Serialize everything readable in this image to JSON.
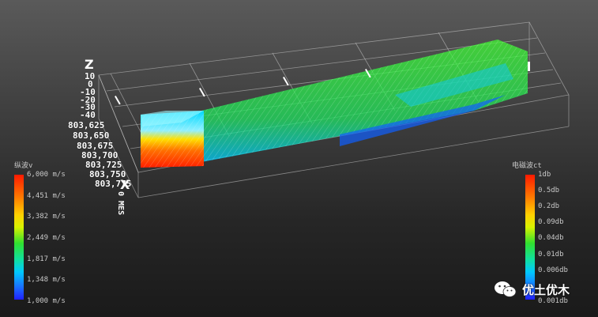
{
  "viewer": {
    "axes": {
      "z_label": "Z",
      "x_label": "X",
      "z_ticks": [
        "10",
        "0",
        "-10",
        "-20",
        "-30",
        "-40"
      ],
      "x_ticks": [
        "803,625",
        "803,650",
        "803,675",
        "803,700",
        "803,725",
        "803,750",
        "803,775"
      ],
      "side_ticks": "0 MES"
    },
    "left_legend": {
      "title": "纵波v",
      "labels": [
        "6,000 m/s",
        "4,451 m/s",
        "3,382 m/s",
        "2,449 m/s",
        "1,817 m/s",
        "1,348 m/s",
        "1,000 m/s"
      ]
    },
    "right_legend": {
      "title": "电磁波ct",
      "labels": [
        "1db",
        "0.5db",
        "0.2db",
        "0.09db",
        "0.04db",
        "0.01db",
        "0.006db",
        "0.001db"
      ]
    },
    "watermark": {
      "text": "优土优木",
      "icon": "wechat-icon"
    },
    "colors": {
      "background_top": "#5a5a5a",
      "background_bottom": "#1a1a1a",
      "red": "#ff1a00",
      "yellow": "#ffd000",
      "green": "#30e030",
      "cyan": "#00c8ff",
      "blue": "#2020ff"
    }
  }
}
